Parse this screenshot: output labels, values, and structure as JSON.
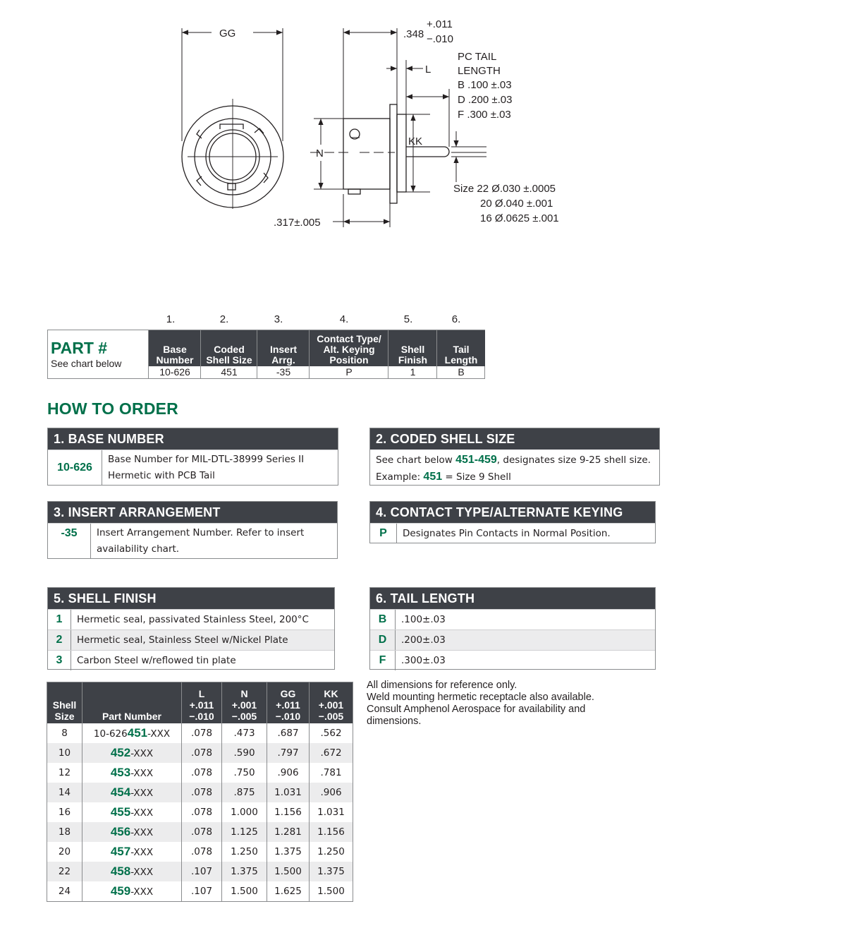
{
  "drawing": {
    "gg": "GG",
    "dim_348": ".348",
    "tol_348_plus": "+.011",
    "tol_348_minus": "−.010",
    "l": "L",
    "tail_title_1": "PC TAIL",
    "tail_title_2": "LENGTH",
    "tail_b": "B .100 ±.03",
    "tail_d": "D .200 ±.03",
    "tail_f": "F .300 ±.03",
    "kk": "KK",
    "n": "N",
    "dim_317": ".317±.005",
    "size_22": "Size 22 Ø.030 ±.0005",
    "size_20": "20 Ø.040 ±.001",
    "size_16": "16 Ø.0625 ±.001"
  },
  "part_number": {
    "title": "PART #",
    "subtitle": "See chart below",
    "columns": [
      {
        "num": "1.",
        "header": [
          "Base",
          "Number"
        ],
        "value": "10-626"
      },
      {
        "num": "2.",
        "header": [
          "Coded",
          "Shell Size"
        ],
        "value": "451"
      },
      {
        "num": "3.",
        "header": [
          "Insert",
          "Arrg."
        ],
        "value": "-35"
      },
      {
        "num": "4.",
        "header": [
          "Contact Type/",
          "Alt. Keying",
          "Position"
        ],
        "value": "P"
      },
      {
        "num": "5.",
        "header": [
          "Shell",
          "Finish"
        ],
        "value": "1"
      },
      {
        "num": "6.",
        "header": [
          "Tail",
          "Length"
        ],
        "value": "B"
      }
    ]
  },
  "how_to_order": "HOW TO ORDER",
  "base_number": {
    "title": "1. BASE NUMBER",
    "code": "10-626",
    "desc_1": "Base Number for MIL-DTL-38999 Series II",
    "desc_2": "Hermetic with PCB Tail"
  },
  "coded_shell": {
    "title": "2. CODED SHELL SIZE",
    "l1_pre": "See chart below ",
    "l1_code": "451-459",
    "l1_post": ", designates size 9-25 shell size.",
    "l2_pre": "Example: ",
    "l2_code": "451",
    "l2_post": " = Size 9 Shell"
  },
  "insert_arr": {
    "title": "3. INSERT ARRANGEMENT",
    "code": "-35",
    "desc_1": "Insert Arrangement Number. Refer to insert",
    "desc_2": "availability chart."
  },
  "contact_type": {
    "title": "4. CONTACT TYPE/ALTERNATE KEYING",
    "code": "P",
    "desc": "Designates Pin Contacts in Normal Position."
  },
  "shell_finish": {
    "title": "5. SHELL FINISH",
    "rows": [
      {
        "code": "1",
        "desc": "Hermetic seal, passivated Stainless Steel, 200°C"
      },
      {
        "code": "2",
        "desc": "Hermetic seal, Stainless Steel w/Nickel Plate"
      },
      {
        "code": "3",
        "desc": "Carbon Steel w/reflowed tin plate"
      }
    ]
  },
  "tail_length": {
    "title": "6. TAIL LENGTH",
    "rows": [
      {
        "code": "B",
        "desc": ".100±.03"
      },
      {
        "code": "D",
        "desc": ".200±.03"
      },
      {
        "code": "F",
        "desc": ".300±.03"
      }
    ]
  },
  "dims_table": {
    "headers": {
      "shell": [
        "Shell",
        "Size"
      ],
      "part": "Part Number",
      "l": [
        "L",
        "+.011",
        "−.010"
      ],
      "n": [
        "N",
        "+.001",
        "−.005"
      ],
      "gg": [
        "GG",
        "+.011",
        "−.010"
      ],
      "kk": [
        "KK",
        "+.001",
        "−.005"
      ]
    },
    "rows": [
      {
        "shell": "8",
        "prefix": "10-626",
        "code": "451",
        "suffix": "-XXX",
        "l": ".078",
        "n": ".473",
        "gg": ".687",
        "kk": ".562"
      },
      {
        "shell": "10",
        "prefix": "",
        "code": "452",
        "suffix": "-XXX",
        "l": ".078",
        "n": ".590",
        "gg": ".797",
        "kk": ".672"
      },
      {
        "shell": "12",
        "prefix": "",
        "code": "453",
        "suffix": "-XXX",
        "l": ".078",
        "n": ".750",
        "gg": ".906",
        "kk": ".781"
      },
      {
        "shell": "14",
        "prefix": "",
        "code": "454",
        "suffix": "-XXX",
        "l": ".078",
        "n": ".875",
        "gg": "1.031",
        "kk": ".906"
      },
      {
        "shell": "16",
        "prefix": "",
        "code": "455",
        "suffix": "-XXX",
        "l": ".078",
        "n": "1.000",
        "gg": "1.156",
        "kk": "1.031"
      },
      {
        "shell": "18",
        "prefix": "",
        "code": "456",
        "suffix": "-XXX",
        "l": ".078",
        "n": "1.125",
        "gg": "1.281",
        "kk": "1.156"
      },
      {
        "shell": "20",
        "prefix": "",
        "code": "457",
        "suffix": "-XXX",
        "l": ".078",
        "n": "1.250",
        "gg": "1.375",
        "kk": "1.250"
      },
      {
        "shell": "22",
        "prefix": "",
        "code": "458",
        "suffix": "-XXX",
        "l": ".107",
        "n": "1.375",
        "gg": "1.500",
        "kk": "1.375"
      },
      {
        "shell": "24",
        "prefix": "",
        "code": "459",
        "suffix": "-XXX",
        "l": ".107",
        "n": "1.500",
        "gg": "1.625",
        "kk": "1.500"
      }
    ]
  },
  "notes": [
    "All dimensions for reference only.",
    "Weld mounting hermetic receptacle also available.",
    "Consult Amphenol Aerospace for availability and",
    "dimensions."
  ],
  "colors": {
    "accent": "#00704a",
    "header_bg": "#3e4147",
    "alt_row": "#ececed"
  }
}
